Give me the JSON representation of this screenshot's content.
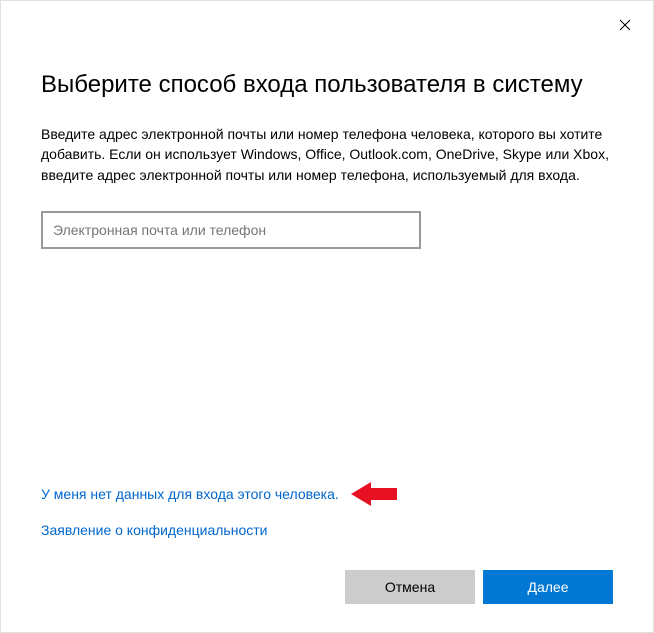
{
  "dialog": {
    "title": "Выберите способ входа пользователя в систему",
    "description": "Введите адрес электронной почты или номер телефона человека, которого вы хотите добавить. Если он использует Windows, Office, Outlook.com, OneDrive, Skype или Xbox, введите адрес электронной почты или номер телефона, используемый для входа.",
    "input": {
      "placeholder": "Электронная почта или телефон",
      "value": ""
    },
    "links": {
      "no_data": "У меня нет данных для входа этого человека.",
      "privacy": "Заявление о конфиденциальности"
    },
    "buttons": {
      "cancel": "Отмена",
      "next": "Далее"
    },
    "annotation": {
      "arrow_color": "#e81123"
    }
  }
}
